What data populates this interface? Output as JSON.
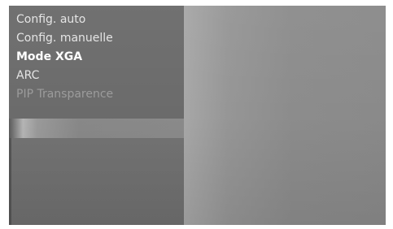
{
  "osd_menu": {
    "items": [
      {
        "label": "Config. auto",
        "state": "normal"
      },
      {
        "label": "Config. manuelle",
        "state": "normal"
      },
      {
        "label": "Mode XGA",
        "state": "selected"
      },
      {
        "label": "ARC",
        "state": "normal"
      },
      {
        "label": "PIP Transparence",
        "state": "disabled"
      }
    ]
  },
  "colors": {
    "panel": "#6b6b6b",
    "text": "#e4e4e4",
    "selected_text": "#ffffff",
    "disabled_text": "#9b9b9b"
  }
}
